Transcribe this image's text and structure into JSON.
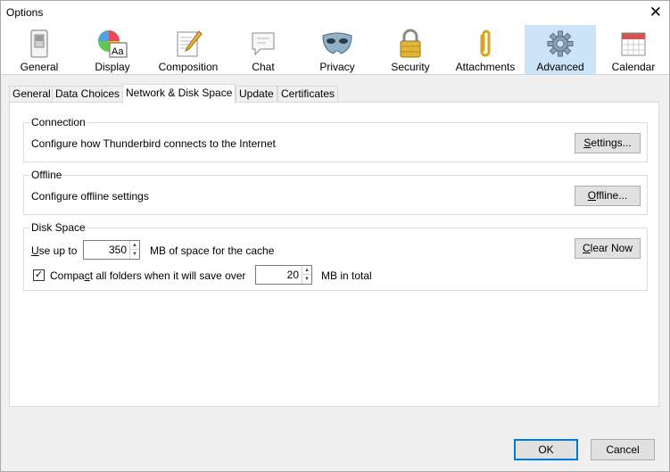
{
  "window": {
    "title": "Options"
  },
  "panes": [
    {
      "label": "General",
      "icon": "general-icon"
    },
    {
      "label": "Display",
      "icon": "display-icon"
    },
    {
      "label": "Composition",
      "icon": "composition-icon"
    },
    {
      "label": "Chat",
      "icon": "chat-icon"
    },
    {
      "label": "Privacy",
      "icon": "privacy-icon"
    },
    {
      "label": "Security",
      "icon": "security-icon"
    },
    {
      "label": "Attachments",
      "icon": "attachments-icon"
    },
    {
      "label": "Advanced",
      "icon": "advanced-icon",
      "selected": true
    },
    {
      "label": "Calendar",
      "icon": "calendar-icon"
    }
  ],
  "tabs": [
    {
      "label": "General"
    },
    {
      "label": "Data Choices"
    },
    {
      "label": "Network & Disk Space",
      "active": true
    },
    {
      "label": "Update"
    },
    {
      "label": "Certificates"
    }
  ],
  "connection": {
    "legend": "Connection",
    "description": "Configure how Thunderbird connects to the Internet",
    "button_u": "S",
    "button_rest": "ettings..."
  },
  "offline": {
    "legend": "Offline",
    "description": "Configure offline settings",
    "button_u": "O",
    "button_rest": "ffline..."
  },
  "disk": {
    "legend": "Disk Space",
    "use_up_u": "U",
    "use_up_rest": "se up to",
    "cache_value": "350",
    "cache_suffix": "MB of space for the cache",
    "clear_u": "C",
    "clear_rest": "lear Now",
    "compact_checked": true,
    "compact_pre": "Compa",
    "compact_u": "c",
    "compact_post": "t all folders when it will save over",
    "compact_value": "20",
    "compact_suffix": "MB in total"
  },
  "footer": {
    "ok": "OK",
    "cancel": "Cancel"
  },
  "colors": {
    "selected_pane": "#cce4f7",
    "default_button_border": "#0078d7"
  }
}
